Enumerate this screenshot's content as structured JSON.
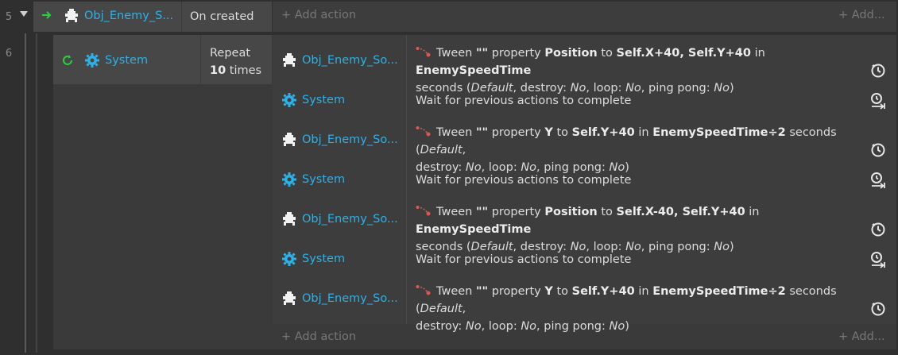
{
  "events": {
    "row5": {
      "line": "5",
      "object": "Obj_Enemy_S...",
      "condition": "On created",
      "add_action": "Add action",
      "add_action_right": "Add..."
    },
    "row6": {
      "line": "6",
      "object": "System",
      "condition_line1": "Repeat",
      "condition_count": "10",
      "condition_suffix": "times",
      "add_action": "Add action",
      "add_action_right": "Add..."
    }
  },
  "actions": [
    {
      "object": "Obj_Enemy_So...",
      "icon": "sprite-icon",
      "kind": "tween",
      "prop": "Position",
      "to": "Self.X+40, Self.Y+40",
      "time": "EnemySpeedTime",
      "line2_prefix": "seconds (",
      "rest": ", destroy: ",
      "destroy": "No",
      "loop_label": ", loop: ",
      "loop": "No",
      "ping_label": ", ping pong: ",
      "ping": "No",
      "end": ")",
      "default": "Default"
    },
    {
      "object": "System",
      "icon": "gear-icon",
      "kind": "wait",
      "text": "Wait for previous actions to complete"
    },
    {
      "object": "Obj_Enemy_So...",
      "icon": "sprite-icon",
      "kind": "tween2",
      "prop": "Y",
      "to": "Self.Y+40",
      "time": "EnemySpeedTime÷2",
      "line1_suffix": " seconds (",
      "default": "Default",
      "comma": ",",
      "line2_prefix": "destroy: ",
      "destroy": "No",
      "loop_label": ", loop: ",
      "loop": "No",
      "ping_label": ", ping pong: ",
      "ping": "No",
      "end": ")"
    },
    {
      "object": "System",
      "icon": "gear-icon",
      "kind": "wait",
      "text": "Wait for previous actions to complete"
    },
    {
      "object": "Obj_Enemy_So...",
      "icon": "sprite-icon",
      "kind": "tween",
      "prop": "Position",
      "to": "Self.X-40, Self.Y+40",
      "time": "EnemySpeedTime",
      "line2_prefix": "seconds (",
      "rest": ", destroy: ",
      "destroy": "No",
      "loop_label": ", loop: ",
      "loop": "No",
      "ping_label": ", ping pong: ",
      "ping": "No",
      "end": ")",
      "default": "Default"
    },
    {
      "object": "System",
      "icon": "gear-icon",
      "kind": "wait",
      "text": "Wait for previous actions to complete"
    },
    {
      "object": "Obj_Enemy_So...",
      "icon": "sprite-icon",
      "kind": "tween2",
      "prop": "Y",
      "to": "Self.Y+40",
      "time": "EnemySpeedTime÷2",
      "line1_suffix": " seconds (",
      "default": "Default",
      "comma": ",",
      "line2_prefix": "destroy: ",
      "destroy": "No",
      "loop_label": ", loop: ",
      "loop": "No",
      "ping_label": ", ping pong: ",
      "ping": "No",
      "end": ")"
    }
  ],
  "labels": {
    "tween": "Tween",
    "quote": "\"\"",
    "property": "property",
    "to": "to",
    "in": "in"
  },
  "colors": {
    "link": "#2fb0e6",
    "trigger_arrow": "#2ecc40",
    "repeat_icon": "#2ecc40",
    "tween_dot": "#e05555"
  }
}
